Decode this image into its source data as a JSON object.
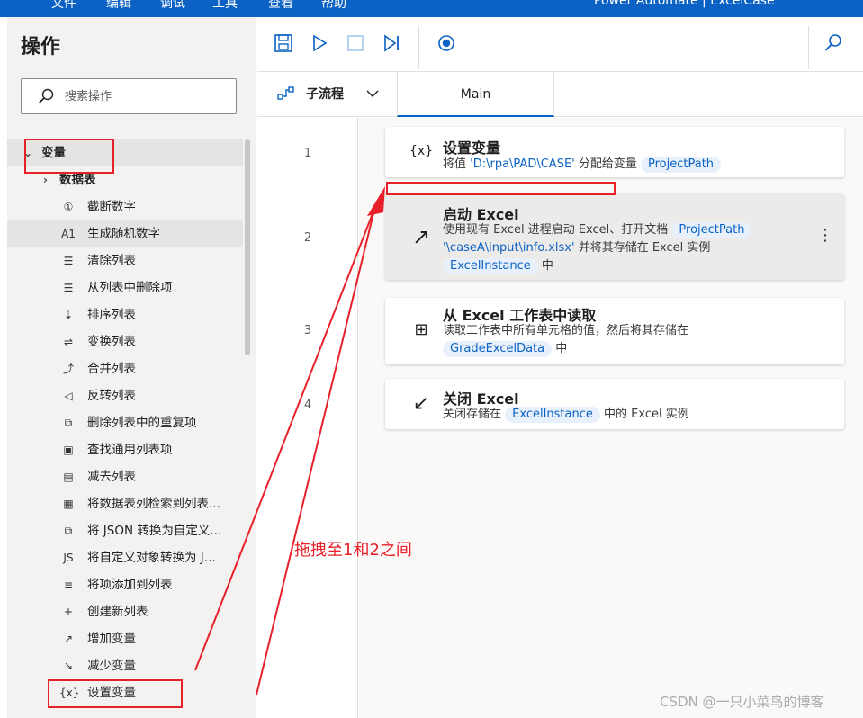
{
  "menu": {
    "items": [
      "文件",
      "编辑",
      "调试",
      "工具",
      "查看",
      "帮助"
    ],
    "window_title": "Power Automate | ExcelCase"
  },
  "actions_panel": {
    "title": "操作",
    "search_placeholder": "搜索操作",
    "group_label": "变量",
    "subgroup_label": "数据表",
    "items": [
      {
        "label": "截断数字",
        "icon": "number-circle-icon",
        "glyph": "①"
      },
      {
        "label": "生成随机数字",
        "icon": "random-number-icon",
        "glyph": "A1"
      },
      {
        "label": "清除列表",
        "icon": "clear-list-icon",
        "glyph": "☰"
      },
      {
        "label": "从列表中删除项",
        "icon": "remove-list-item-icon",
        "glyph": "☰"
      },
      {
        "label": "排序列表",
        "icon": "sort-list-icon",
        "glyph": "⇣"
      },
      {
        "label": "变换列表",
        "icon": "shuffle-list-icon",
        "glyph": "⇌"
      },
      {
        "label": "合并列表",
        "icon": "merge-list-icon",
        "glyph": "⤴"
      },
      {
        "label": "反转列表",
        "icon": "reverse-list-icon",
        "glyph": "◁"
      },
      {
        "label": "删除列表中的重复项",
        "icon": "remove-duplicates-icon",
        "glyph": "⧉"
      },
      {
        "label": "查找通用列表项",
        "icon": "find-common-items-icon",
        "glyph": "▣"
      },
      {
        "label": "减去列表",
        "icon": "subtract-list-icon",
        "glyph": "▤"
      },
      {
        "label": "将数据表列检索到列表...",
        "icon": "datatable-column-icon",
        "glyph": "▦"
      },
      {
        "label": "将 JSON 转换为自定义...",
        "icon": "json-convert-icon",
        "glyph": "⧉"
      },
      {
        "label": "将自定义对象转换为 J...",
        "icon": "js-object-icon",
        "glyph": "JS"
      },
      {
        "label": "将项添加到列表",
        "icon": "add-item-list-icon",
        "glyph": "≡"
      },
      {
        "label": "创建新列表",
        "icon": "plus-icon",
        "glyph": "+"
      },
      {
        "label": "增加变量",
        "icon": "increase-trend-icon",
        "glyph": "↗"
      },
      {
        "label": "减少变量",
        "icon": "decrease-trend-icon",
        "glyph": "↘"
      },
      {
        "label": "设置变量",
        "icon": "variable-braces-icon",
        "glyph": "{x}"
      }
    ]
  },
  "tabs": {
    "subflow_label": "子流程",
    "main_tab": "Main"
  },
  "flow": {
    "steps": [
      {
        "num": "1",
        "title": "设置变量",
        "icon": "variable-braces-icon",
        "glyph": "{x}",
        "desc_pre": "将值 ",
        "desc_value": "'D:\\rpa\\PAD\\CASE'",
        "desc_mid": " 分配给变量 ",
        "chip1": "ProjectPath"
      },
      {
        "num": "2",
        "title": "启动 Excel",
        "icon": "launch-arrow-icon",
        "glyph": "↗",
        "line1": "使用现有 Excel 进程启动 Excel、打开文档",
        "chip1": "ProjectPath",
        "line2_path": "'\\caseA\\input\\info.xlsx'",
        "line2_rest": " 并将其存储在 Excel 实例",
        "chip2": "ExcelInstance",
        "line3_rest": " 中"
      },
      {
        "num": "3",
        "title": "从 Excel 工作表中读取",
        "icon": "excel-read-icon",
        "glyph": "⊞",
        "line1": "读取工作表中所有单元格的值，然后将其存储在",
        "chip1": "GradeExcelData",
        "line2_rest": " 中"
      },
      {
        "num": "4",
        "title": "关闭 Excel",
        "icon": "close-arrow-icon",
        "glyph": "↙",
        "pre": "关闭存储在 ",
        "chip1": "ExcelInstance",
        "post": " 中的 Excel 实例"
      }
    ]
  },
  "annotation": {
    "text": "拖拽至1和2之间",
    "color": "#e8202a"
  },
  "watermark": "CSDN @一只小菜鸟的博客",
  "colors": {
    "accent": "#0b62c4",
    "chip_bg": "#e8f1fb",
    "panel_bg": "#f3f2f1",
    "annotation_red": "#e8202a"
  }
}
